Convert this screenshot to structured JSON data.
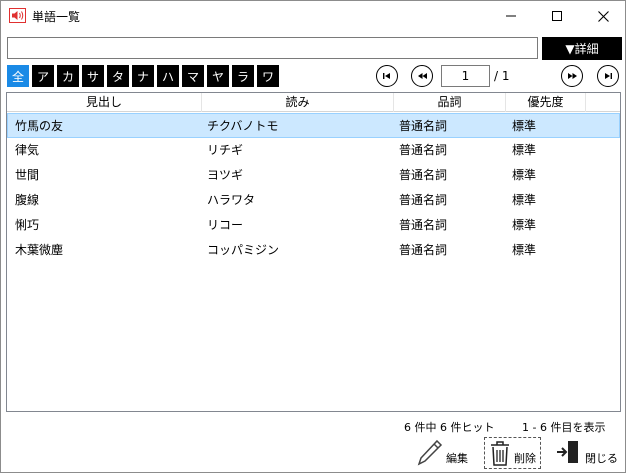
{
  "window": {
    "title": "単語一覧",
    "minimize_glyph": "—",
    "maximize_glyph": "☐",
    "close_glyph": "✕"
  },
  "search": {
    "value": "",
    "placeholder": ""
  },
  "detail_button": {
    "label": "▼詳細"
  },
  "kana_filter": [
    "全",
    "ア",
    "カ",
    "サ",
    "タ",
    "ナ",
    "ハ",
    "マ",
    "ヤ",
    "ラ",
    "ワ"
  ],
  "kana_selected": "全",
  "pager": {
    "current": "1",
    "total_label": "/ 1"
  },
  "table": {
    "columns": [
      "見出し",
      "読み",
      "品詞",
      "優先度"
    ],
    "rows": [
      [
        "竹馬の友",
        "チクバノトモ",
        "普通名詞",
        "標準"
      ],
      [
        "律気",
        "リチギ",
        "普通名詞",
        "標準"
      ],
      [
        "世間",
        "ヨツギ",
        "普通名詞",
        "標準"
      ],
      [
        "腹線",
        "ハラワタ",
        "普通名詞",
        "標準"
      ],
      [
        "悧巧",
        "リコー",
        "普通名詞",
        "標準"
      ],
      [
        "木葉微塵",
        "コッパミジン",
        "普通名詞",
        "標準"
      ]
    ],
    "selected_row": 0
  },
  "status": {
    "hits": "6 件中 6 件ヒット",
    "range": "1 - 6 件目を表示"
  },
  "actions": {
    "edit": "編集",
    "delete": "削除",
    "close": "閉じる"
  },
  "colors": {
    "accent": "#1a8ae6",
    "selection": "#cce8ff",
    "icon_red": "#e03030"
  }
}
